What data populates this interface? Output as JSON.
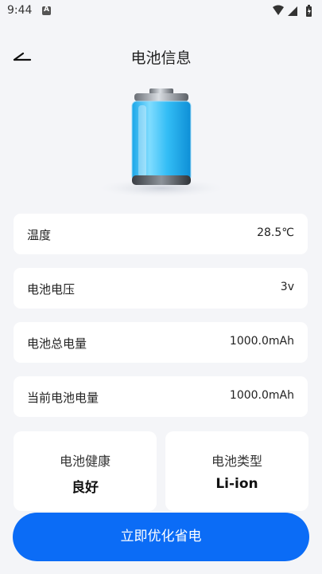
{
  "status_bar": {
    "time": "9:44",
    "notification_badge": "A",
    "icons": [
      "wifi-icon",
      "cellular-signal-icon",
      "battery-status-icon"
    ]
  },
  "header": {
    "back_icon": "back-arrow-icon",
    "title": "电池信息"
  },
  "battery_illustration": {
    "icon": "battery-icon",
    "fill_color": "#33bdf5"
  },
  "info_rows": [
    {
      "label": "温度",
      "value": "28.5℃"
    },
    {
      "label": "电池电压",
      "value": "3v"
    },
    {
      "label": "电池总电量",
      "value": "1000.0mAh"
    },
    {
      "label": "当前电池电量",
      "value": "1000.0mAh"
    }
  ],
  "stat_cards": [
    {
      "label": "电池健康",
      "value": "良好"
    },
    {
      "label": "电池类型",
      "value": "Li-ion"
    }
  ],
  "optimize_button": {
    "label": "立即优化省电",
    "color": "#0b6cf6"
  }
}
